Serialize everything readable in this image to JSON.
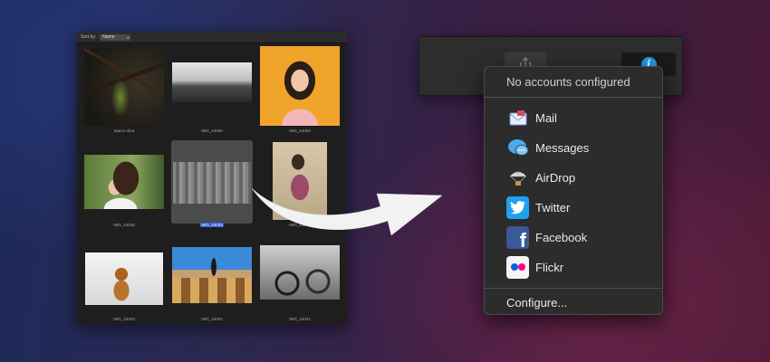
{
  "browser": {
    "sort_label": "Sort by:",
    "sort_value": "Name",
    "photos": [
      {
        "caption": "Macro shot",
        "selected": false
      },
      {
        "caption": "IMG_44056",
        "selected": false
      },
      {
        "caption": "IMG_44053",
        "selected": false
      },
      {
        "caption": "IMG_44036",
        "selected": false
      },
      {
        "caption": "IMG_44033",
        "selected": true
      },
      {
        "caption": "IMG_44032",
        "selected": false
      },
      {
        "caption": "IMG_44023",
        "selected": false
      },
      {
        "caption": "IMG_44022",
        "selected": false
      },
      {
        "caption": "IMG_44021",
        "selected": false
      }
    ]
  },
  "share_menu": {
    "header": "No accounts configured",
    "items": [
      {
        "label": "Mail",
        "icon": "mail-icon"
      },
      {
        "label": "Messages",
        "icon": "messages-icon"
      },
      {
        "label": "AirDrop",
        "icon": "airdrop-icon"
      },
      {
        "label": "Twitter",
        "icon": "twitter-icon"
      },
      {
        "label": "Facebook",
        "icon": "facebook-icon"
      },
      {
        "label": "Flickr",
        "icon": "flickr-icon"
      }
    ],
    "footer": "Configure..."
  },
  "colors": {
    "selection": "#2a5fd7",
    "info_accent": "#1b9cf0",
    "twitter": "#1da1f2",
    "facebook": "#3b5998"
  }
}
